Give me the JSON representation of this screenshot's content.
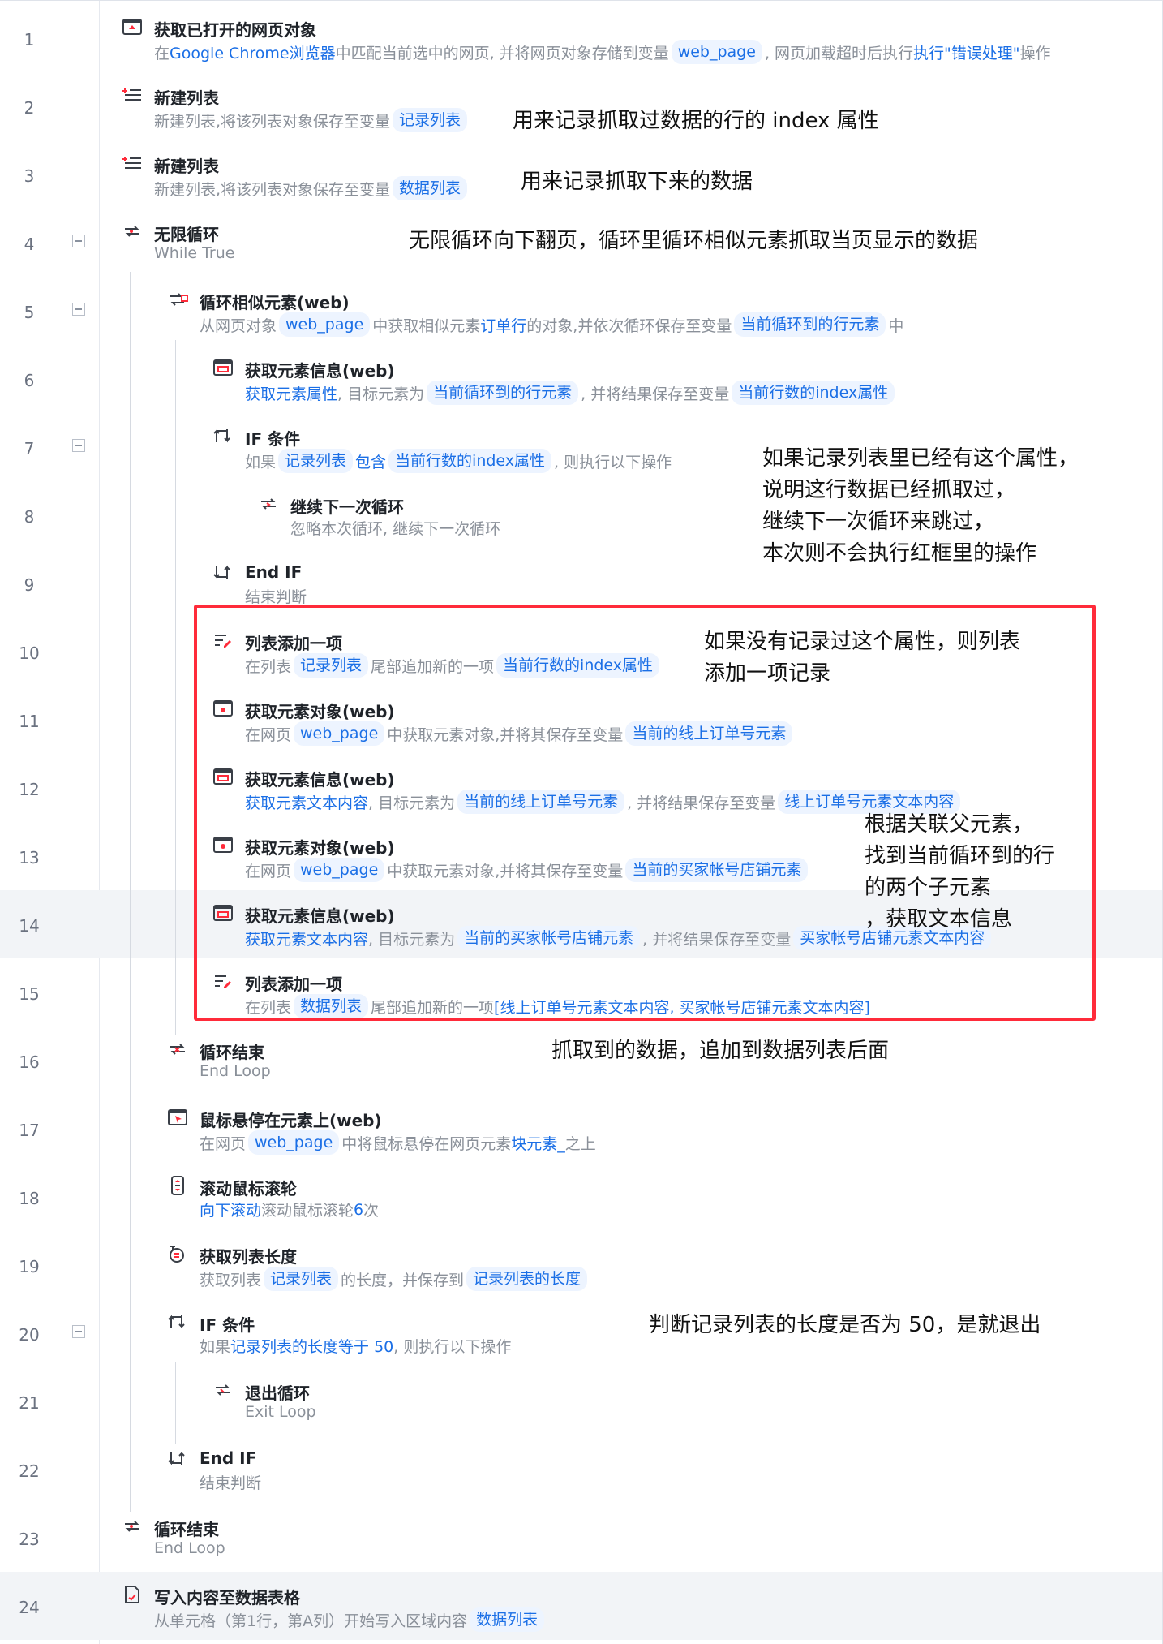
{
  "steps": [
    {
      "num": "1",
      "title": "获取已打开的网页对象",
      "icon": "browser-upload-icon",
      "desc": [
        {
          "t": "在",
          "c": "g"
        },
        {
          "t": "Google Chrome浏览器",
          "c": "b"
        },
        {
          "t": "中匹配当前选中的网页, 并将网页对象存储到变量",
          "c": "g"
        },
        {
          "t": "web_page",
          "c": "chip"
        },
        {
          "t": ", 网页加载超时后执行 ",
          "c": "g"
        },
        {
          "t": "执行\"错误处理\"",
          "c": "b"
        },
        {
          "t": " 操作",
          "c": "g"
        }
      ]
    },
    {
      "num": "2",
      "title": "新建列表",
      "icon": "new-list-icon",
      "desc": [
        {
          "t": "新建列表,将该列表对象保存至变量",
          "c": "g"
        },
        {
          "t": "记录列表",
          "c": "chip"
        }
      ]
    },
    {
      "num": "3",
      "title": "新建列表",
      "icon": "new-list-icon",
      "desc": [
        {
          "t": "新建列表,将该列表对象保存至变量",
          "c": "g"
        },
        {
          "t": "数据列表",
          "c": "chip"
        }
      ]
    },
    {
      "num": "4",
      "title": "无限循环",
      "icon": "loop-icon",
      "desc": [
        {
          "t": "While True",
          "c": "g"
        }
      ]
    },
    {
      "num": "5",
      "title": "循环相似元素(web)",
      "icon": "loop-element-icon",
      "desc": [
        {
          "t": "从网页对象",
          "c": "g"
        },
        {
          "t": "web_page",
          "c": "chip"
        },
        {
          "t": "中获取相似元素",
          "c": "g"
        },
        {
          "t": "订单行",
          "c": "b"
        },
        {
          "t": "的对象,并依次循环保存至变量",
          "c": "g"
        },
        {
          "t": "当前循环到的行元素",
          "c": "chip"
        },
        {
          "t": "中",
          "c": "g"
        }
      ]
    },
    {
      "num": "6",
      "title": "获取元素信息(web)",
      "icon": "element-info-icon",
      "desc": [
        {
          "t": "获取元素属性",
          "c": "b"
        },
        {
          "t": ", 目标元素为",
          "c": "g"
        },
        {
          "t": "当前循环到的行元素",
          "c": "chip"
        },
        {
          "t": ", 并将结果保存至变量",
          "c": "g"
        },
        {
          "t": "当前行数的index属性",
          "c": "chip"
        }
      ]
    },
    {
      "num": "7",
      "title": "IF 条件",
      "icon": "if-icon",
      "desc": [
        {
          "t": "如果",
          "c": "g"
        },
        {
          "t": "记录列表",
          "c": "chip"
        },
        {
          "t": "包含",
          "c": "b"
        },
        {
          "t": "当前行数的index属性",
          "c": "chip"
        },
        {
          "t": ", 则执行以下操作",
          "c": "g"
        }
      ]
    },
    {
      "num": "8",
      "title": "继续下一次循环",
      "icon": "continue-loop-icon",
      "desc": [
        {
          "t": "忽略本次循环, 继续下一次循环",
          "c": "g"
        }
      ]
    },
    {
      "num": "9",
      "title": "End IF",
      "icon": "end-if-icon",
      "desc": [
        {
          "t": "结束判断",
          "c": "g"
        }
      ]
    },
    {
      "num": "10",
      "title": "列表添加一项",
      "icon": "list-add-icon",
      "desc": [
        {
          "t": "在列表",
          "c": "g"
        },
        {
          "t": "记录列表",
          "c": "chip"
        },
        {
          "t": "尾部追加新的一项",
          "c": "g"
        },
        {
          "t": "当前行数的index属性",
          "c": "chip"
        }
      ]
    },
    {
      "num": "11",
      "title": "获取元素对象(web)",
      "icon": "element-object-icon",
      "desc": [
        {
          "t": "在网页",
          "c": "g"
        },
        {
          "t": "web_page",
          "c": "chip"
        },
        {
          "t": "中获取元素对象,并将其保存至变量",
          "c": "g"
        },
        {
          "t": "当前的线上订单号元素",
          "c": "chip"
        }
      ]
    },
    {
      "num": "12",
      "title": "获取元素信息(web)",
      "icon": "element-info-icon",
      "desc": [
        {
          "t": "获取元素文本内容",
          "c": "b"
        },
        {
          "t": ", 目标元素为",
          "c": "g"
        },
        {
          "t": "当前的线上订单号元素",
          "c": "chip"
        },
        {
          "t": ", 并将结果保存至变量",
          "c": "g"
        },
        {
          "t": "线上订单号元素文本内容",
          "c": "chip"
        }
      ]
    },
    {
      "num": "13",
      "title": "获取元素对象(web)",
      "icon": "element-object-icon",
      "desc": [
        {
          "t": "在网页",
          "c": "g"
        },
        {
          "t": "web_page",
          "c": "chip"
        },
        {
          "t": "中获取元素对象,并将其保存至变量",
          "c": "g"
        },
        {
          "t": "当前的买家帐号店铺元素",
          "c": "chip"
        }
      ]
    },
    {
      "num": "14",
      "title": "获取元素信息(web)",
      "icon": "element-info-icon",
      "desc": [
        {
          "t": "获取元素文本内容",
          "c": "b"
        },
        {
          "t": ", 目标元素为",
          "c": "g"
        },
        {
          "t": "当前的买家帐号店铺元素",
          "c": "chip"
        },
        {
          "t": ", 并将结果保存至变量",
          "c": "g"
        },
        {
          "t": "买家帐号店铺元素文本内容",
          "c": "chip"
        }
      ]
    },
    {
      "num": "15",
      "title": "列表添加一项",
      "icon": "list-add-icon",
      "desc": [
        {
          "t": "在列表",
          "c": "g"
        },
        {
          "t": "数据列表",
          "c": "chip"
        },
        {
          "t": "尾部追加新的一项",
          "c": "g"
        },
        {
          "t": "[线上订单号元素文本内容, 买家帐号店铺元素文本内容]",
          "c": "b"
        }
      ]
    },
    {
      "num": "16",
      "title": "循环结束",
      "icon": "loop-end-icon",
      "desc": [
        {
          "t": "End Loop",
          "c": "g"
        }
      ]
    },
    {
      "num": "17",
      "title": "鼠标悬停在元素上(web)",
      "icon": "mouse-hover-icon",
      "desc": [
        {
          "t": "在网页",
          "c": "g"
        },
        {
          "t": "web_page",
          "c": "chip"
        },
        {
          "t": "中将鼠标悬停在网页元素",
          "c": "g"
        },
        {
          "t": "块元素_",
          "c": "b"
        },
        {
          "t": "之上",
          "c": "g"
        }
      ]
    },
    {
      "num": "18",
      "title": "滚动鼠标滚轮",
      "icon": "scroll-wheel-icon",
      "desc": [
        {
          "t": "向下滚动",
          "c": "b"
        },
        {
          "t": " 滚动鼠标滚轮 ",
          "c": "g"
        },
        {
          "t": "6",
          "c": "b"
        },
        {
          "t": " 次",
          "c": "g"
        }
      ]
    },
    {
      "num": "19",
      "title": "获取列表长度",
      "icon": "list-length-icon",
      "desc": [
        {
          "t": "获取列表",
          "c": "g"
        },
        {
          "t": "记录列表",
          "c": "chip"
        },
        {
          "t": "的长度，并保存到",
          "c": "g"
        },
        {
          "t": "记录列表的长度",
          "c": "chip"
        }
      ]
    },
    {
      "num": "20",
      "title": "IF 条件",
      "icon": "if-icon",
      "desc": [
        {
          "t": "如果",
          "c": "g"
        },
        {
          "t": "记录列表的长度",
          "c": "b"
        },
        {
          "t": " 等于 50",
          "c": "b"
        },
        {
          "t": ", 则执行以下操作",
          "c": "g"
        }
      ]
    },
    {
      "num": "21",
      "title": "退出循环",
      "icon": "exit-loop-icon",
      "desc": [
        {
          "t": "Exit Loop",
          "c": "g"
        }
      ]
    },
    {
      "num": "22",
      "title": "End IF",
      "icon": "end-if-icon",
      "desc": [
        {
          "t": "结束判断",
          "c": "g"
        }
      ]
    },
    {
      "num": "23",
      "title": "循环结束",
      "icon": "loop-icon",
      "desc": [
        {
          "t": "End Loop",
          "c": "g"
        }
      ]
    },
    {
      "num": "24",
      "title": "写入内容至数据表格",
      "icon": "write-sheet-icon",
      "desc": [
        {
          "t": "从单元格（第1行，第A列）开始写入区域内容",
          "c": "g"
        },
        {
          "t": "数据列表",
          "c": "chip"
        }
      ]
    }
  ],
  "annotations": {
    "note_record_list": "用来记录抓取过数据的行的 index 属性",
    "note_data_list": "用来记录抓取下来的数据",
    "note_infinite_loop": "无限循环向下翻页，循环里循环相似元素抓取当页显示的数据",
    "note_if_exists": [
      "如果记录列表里已经有这个属性，",
      "说明这行数据已经抓取过，",
      "继续下一次循环来跳过，",
      "本次则不会执行红框里的操作"
    ],
    "note_add_record": [
      "如果没有记录过这个属性，则列表",
      "添加一项记录"
    ],
    "note_parent_element": [
      "根据关联父元素，",
      "找到当前循环到的行",
      "的两个子元素",
      "，获取文本信息"
    ],
    "note_append_data": "抓取到的数据，追加到数据列表后面",
    "note_exit_condition": "判断记录列表的长度是否为 50，是就退出"
  },
  "colors": {
    "accent_blue": "#1b6fe6",
    "highlight_red": "#ff2b3a",
    "chip_bg": "#edf4ff"
  }
}
